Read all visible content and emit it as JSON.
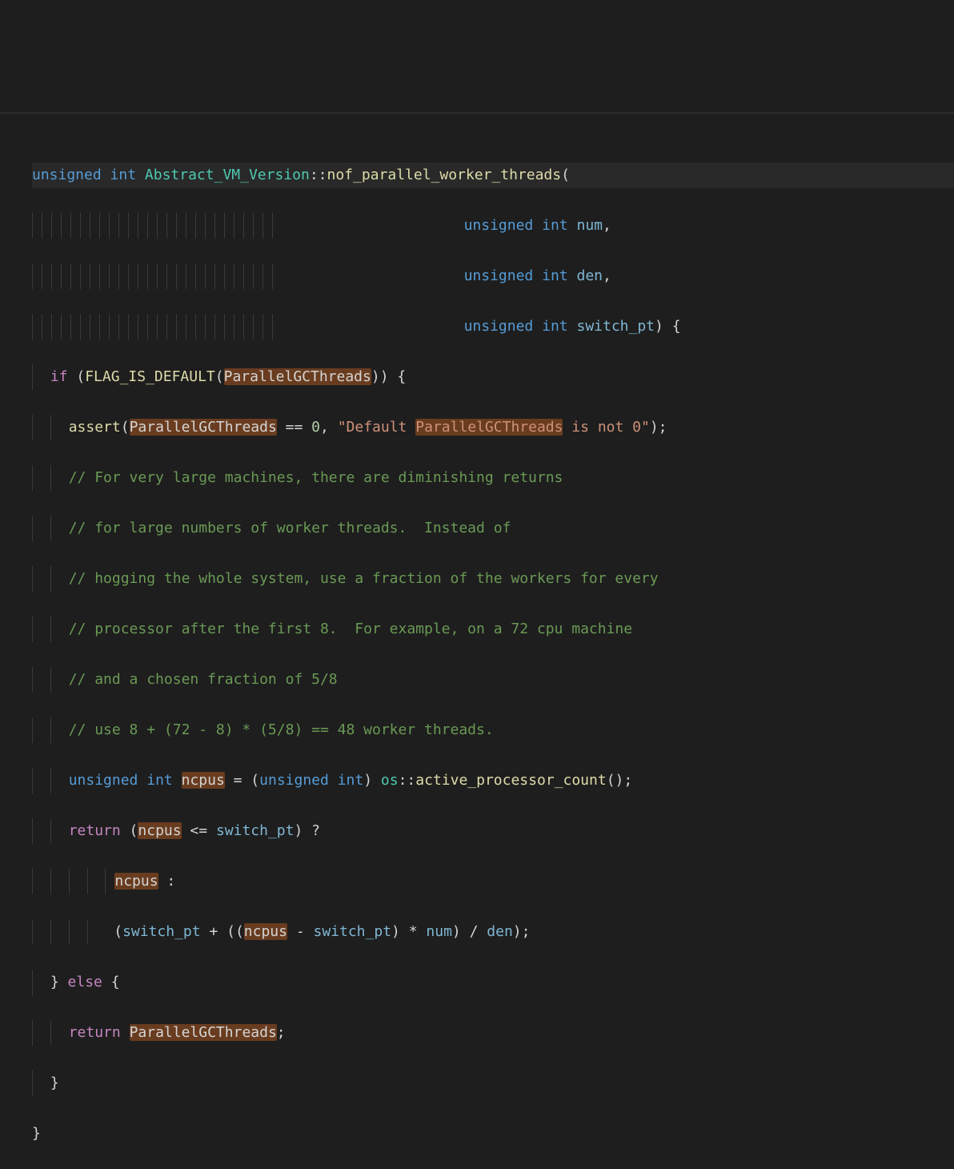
{
  "code": {
    "l1": {
      "kw1": "unsigned",
      "kw2": "int",
      "cls": "Abstract_VM_Version",
      "op": "::",
      "fn": "nof_parallel_worker_threads",
      "open": "("
    },
    "l2": {
      "kw1": "unsigned",
      "kw2": "int",
      "param": "num",
      "comma": ","
    },
    "l3": {
      "kw1": "unsigned",
      "kw2": "int",
      "param": "den",
      "comma": ","
    },
    "l4": {
      "kw1": "unsigned",
      "kw2": "int",
      "param": "switch_pt",
      "close": ")",
      "brace": " {"
    },
    "l5": {
      "kw": "if",
      "open": " (",
      "fn": "FLAG_IS_DEFAULT",
      "popen": "(",
      "arg": "ParallelGCThreads",
      "pclose": ")",
      "close": ")",
      "brace": " {"
    },
    "l6": {
      "fn": "assert",
      "open": "(",
      "arg1": "ParallelGCThreads",
      "eq": " == ",
      "zero": "0",
      "comma": ", ",
      "str1": "\"Default ",
      "str_hi": "ParallelGCThreads",
      "str2": " is not 0\"",
      "close": ");"
    },
    "l7": {
      "c": "// For very large machines, there are diminishing returns"
    },
    "l8": {
      "c": "// for large numbers of worker threads.  Instead of"
    },
    "l9": {
      "c": "// hogging the whole system, use a fraction of the workers for every"
    },
    "l10": {
      "c": "// processor after the first 8.  For example, on a 72 cpu machine"
    },
    "l11": {
      "c": "// and a chosen fraction of 5/8"
    },
    "l12": {
      "c": "// use 8 + (72 - 8) * (5/8) == 48 worker threads."
    },
    "l13": {
      "kw1": "unsigned",
      "kw2": "int",
      "var": "ncpus",
      "eq": " = (",
      "kw3": "unsigned",
      "kw4": "int",
      "close": ") ",
      "cls": "os",
      "op": "::",
      "fn": "active_processor_count",
      "tail": "();"
    },
    "l14": {
      "kw": "return",
      "open": " (",
      "var": "ncpus",
      "cmp": " <= ",
      "param": "switch_pt",
      "close": ") ?"
    },
    "l15": {
      "var": "ncpus",
      "tail": " :"
    },
    "l16": {
      "open": "(",
      "p1": "switch_pt",
      "plus": " + ((",
      "var": "ncpus",
      "minus": " - ",
      "p2": "switch_pt",
      "mul": ") * ",
      "p3": "num",
      "div": ") / ",
      "p4": "den",
      "close": ");"
    },
    "l17": {
      "close": "} ",
      "kw": "else",
      "brace": " {"
    },
    "l18": {
      "kw": "return",
      "sp": " ",
      "var": "ParallelGCThreads",
      "tail": ";"
    },
    "l19": {
      "brace": "}"
    },
    "l20": {
      "brace": "}"
    }
  }
}
